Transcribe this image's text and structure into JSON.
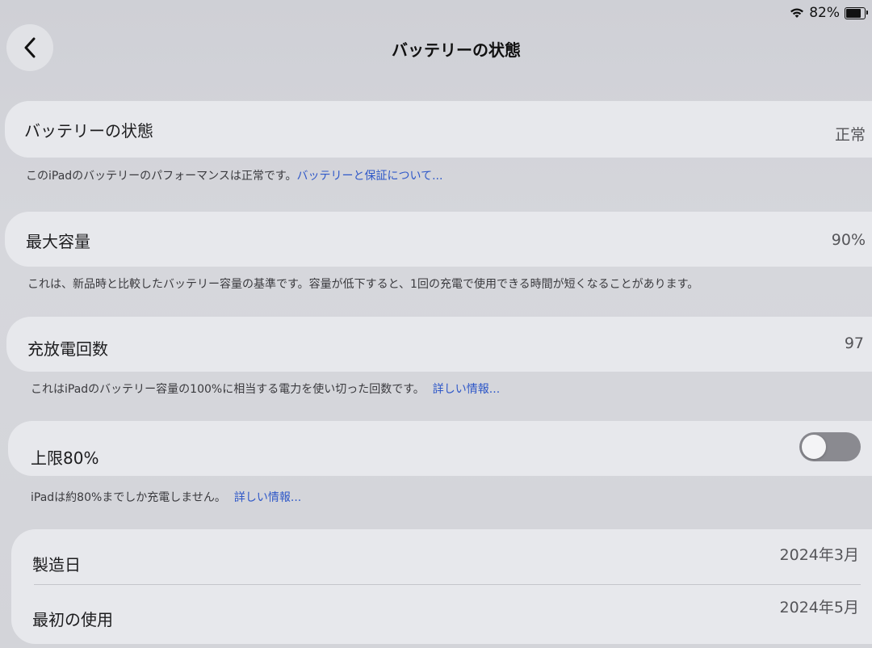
{
  "status_bar": {
    "wifi_icon": "wifi-icon",
    "battery_percent": "82%",
    "battery_level": 0.82
  },
  "nav": {
    "back_icon": "chevron-left-icon",
    "title": "バッテリーの状態"
  },
  "battery_health": {
    "label": "バッテリーの状態",
    "value": "正常",
    "footnote_text": "このiPadのバッテリーのパフォーマンスは正常です。",
    "footnote_link": "バッテリーと保証について..."
  },
  "max_capacity": {
    "label": "最大容量",
    "value": "90%",
    "footnote_text": "これは、新品時と比較したバッテリー容量の基準です。容量が低下すると、1回の充電で使用できる時間が短くなることがあります。"
  },
  "cycle_count": {
    "label": "充放電回数",
    "value": "97",
    "footnote_text": "これはiPadのバッテリー容量の100%に相当する電力を使い切った回数です。",
    "footnote_link": "詳しい情報..."
  },
  "limit_80": {
    "label": "上限80%",
    "enabled": false,
    "footnote_text": "iPadは約80%までしか充電しません。",
    "footnote_link": "詳しい情報..."
  },
  "dates": {
    "manufacture_label": "製造日",
    "manufacture_value": "2024年3月",
    "first_use_label": "最初の使用",
    "first_use_value": "2024年5月"
  },
  "colors": {
    "link": "#2f58c8",
    "toggle_off": "#8a8a90",
    "card": "#e7e8ec"
  }
}
